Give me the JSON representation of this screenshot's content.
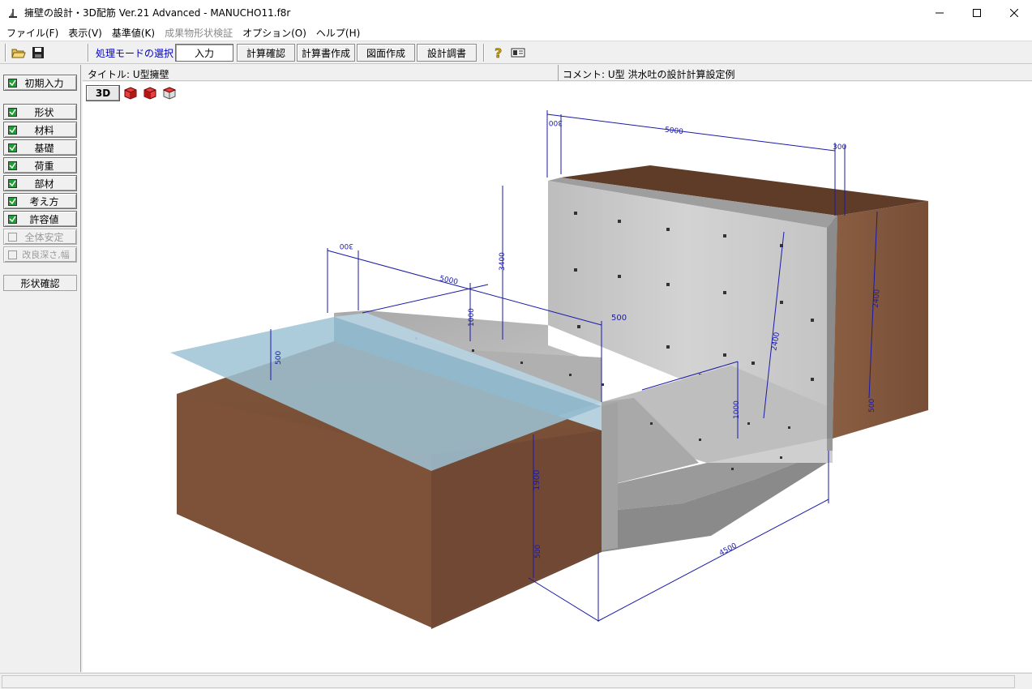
{
  "window": {
    "title": "擁壁の設計・3D配筋 Ver.21 Advanced  - MANUCHO11.f8r",
    "minimize": "—",
    "maximize": "☐",
    "close": "✕"
  },
  "menu": [
    "ファイル(F)",
    "表示(V)",
    "基準値(K)",
    "成果物形状検証",
    "オプション(O)",
    "ヘルプ(H)"
  ],
  "toolbar": {
    "mode_label": "処理モードの選択",
    "modes": [
      "入力",
      "計算確認",
      "計算書作成",
      "図面作成",
      "設計調書"
    ],
    "active_mode": "入力"
  },
  "sidebar": {
    "initial": "初期入力",
    "items": [
      {
        "label": "形状",
        "checked": true
      },
      {
        "label": "材料",
        "checked": true
      },
      {
        "label": "基礎",
        "checked": true
      },
      {
        "label": "荷重",
        "checked": true
      },
      {
        "label": "部材",
        "checked": true
      },
      {
        "label": "考え方",
        "checked": true
      },
      {
        "label": "許容値",
        "checked": true
      },
      {
        "label": "全体安定",
        "checked": false,
        "disabled": true
      },
      {
        "label": "改良深さ,幅",
        "checked": false,
        "disabled": true
      }
    ],
    "shape_check": "形状確認"
  },
  "info": {
    "title": "タイトル: U型擁壁",
    "comment": "コメント: U型 洪水吐の設計計算設定例"
  },
  "viewport": {
    "btn_3d": "3D",
    "dimensions": {
      "top_width": "5000",
      "top_left_wall": "300",
      "top_right_wall": "300",
      "left_width": "5000",
      "left_wall": "300",
      "wall_height": "3400",
      "step_height": "1000",
      "step_width": "500",
      "inner_height": "2400",
      "right_height": "2400",
      "notch_height": "1000",
      "base_right": "500",
      "front_height": "1900",
      "base_front": "500",
      "bottom_width": "4500",
      "water_dim": "500"
    }
  },
  "colors": {
    "dimension_line": "#1a1aa8",
    "soil": "#7a4e33",
    "concrete": "#c8c8c8",
    "water": "#9ec3d6",
    "check_green": "#1e9e35"
  }
}
